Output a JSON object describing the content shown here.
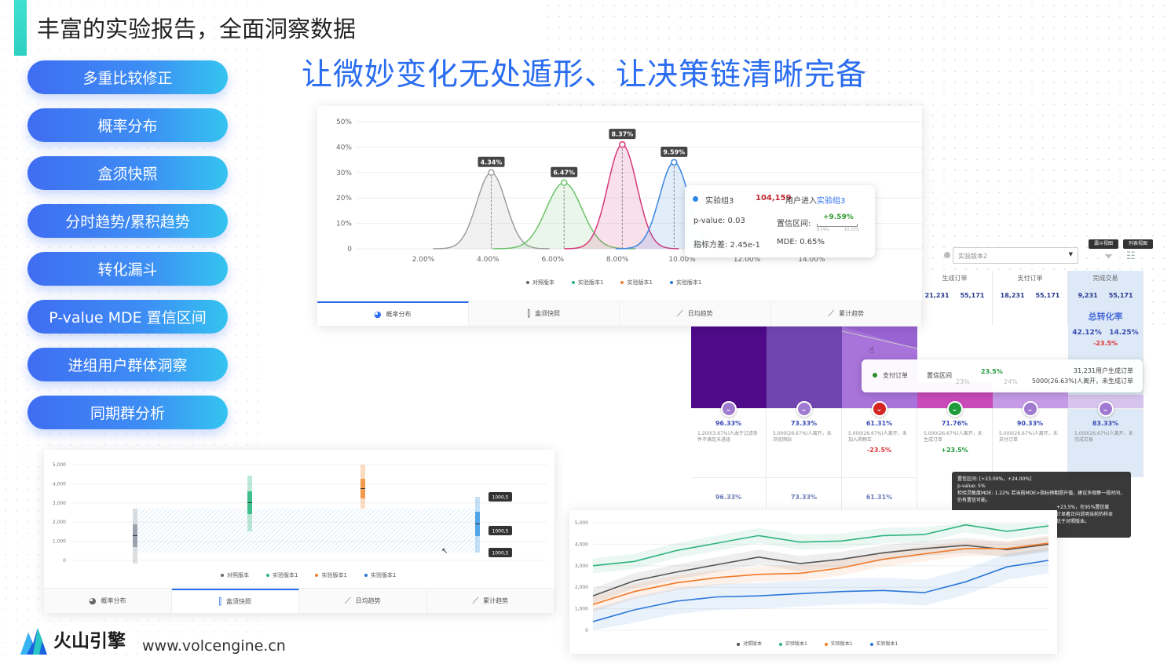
{
  "heading": "丰富的实验报告，全面洞察数据",
  "tagline": "让微妙变化无处遁形、让决策链清晰完备",
  "features": [
    "多重比较修正",
    "概率分布",
    "盒须快照",
    "分时趋势/累积趋势",
    "转化漏斗",
    "P-value MDE  置信区间",
    "进组用户群体洞察",
    "同期群分析"
  ],
  "tabs": [
    "概率分布",
    "盒须快照",
    "日均趋势",
    "累计趋势"
  ],
  "legend": [
    "对照版本",
    "实验版本1",
    "实验版本1",
    "实验版本1"
  ],
  "brand": {
    "name": "火山引擎",
    "url": "www.volcengine.cn"
  },
  "dist_chart": {
    "yticks": [
      "50%",
      "40%",
      "30%",
      "20%",
      "10%",
      "0"
    ],
    "xticks": [
      "2.00%",
      "4.00%",
      "6.00%",
      "8.00%",
      "10.00%",
      "12.00%",
      "14.00%"
    ],
    "peaks": [
      {
        "label": "4.34%",
        "mean": 4.1,
        "height": 0.3,
        "sd": 0.45,
        "color": "#9e9e9e"
      },
      {
        "label": "6.47%",
        "mean": 6.35,
        "height": 0.26,
        "sd": 0.55,
        "color": "#6cc26a"
      },
      {
        "label": "8.37%",
        "mean": 8.15,
        "height": 0.41,
        "sd": 0.45,
        "color": "#d6387a"
      },
      {
        "label": "9.59%",
        "mean": 9.75,
        "height": 0.34,
        "sd": 0.45,
        "color": "#3b86e0"
      }
    ],
    "tooltip": {
      "group": "实验组3",
      "users_count": "104,159",
      "users_text": "用户进入",
      "users_target": "实验组3",
      "pvalue": "p-value: 0.03",
      "ci_label": "置信区间:",
      "ci_value": "+9.59%",
      "ci_lo": "8.59%",
      "ci_hi": "10.23%",
      "variance": "指标方差: 2.45e-1",
      "mde": "MDE: 0.65%"
    }
  },
  "funnel": {
    "select_placeholder": "实验版本2",
    "view_buttons": [
      "漏斗视图",
      "列表视图"
    ],
    "columns": [
      {
        "title": "",
        "nums": [
          "",
          ""
        ]
      },
      {
        "title": "",
        "nums": [
          "",
          ""
        ]
      },
      {
        "title": "",
        "nums": [
          "",
          ""
        ]
      },
      {
        "title": "生成订单",
        "nums": [
          "21,231",
          "55,171"
        ]
      },
      {
        "title": "支付订单",
        "nums": [
          "18,231",
          "55,171"
        ]
      },
      {
        "title": "完成交易",
        "nums": [
          "9,231",
          "55,171"
        ]
      }
    ],
    "total_label": "总转化率",
    "total_vals": [
      "42.12%",
      "14.25%"
    ],
    "total_delta": "-23.5%",
    "tooltip": {
      "name": "支付订单",
      "ci_label": "置信区间",
      "ci": "23.5%",
      "lo": "23%",
      "hi": "24%",
      "line1": "31,231用户生成订单",
      "line2": "5000(26.63%)人离开，未生成订单"
    },
    "stats": [
      {
        "pct": "96.33%",
        "desc": "1,200(3.67%)人由于过滤条件不满足未进组",
        "delta": ""
      },
      {
        "pct": "73.33%",
        "desc": "5,000(26.67%)人离开，未浏览网站",
        "delta": ""
      },
      {
        "pct": "61.31%",
        "desc": "5,000(26.67%)人离开，未加入购物车",
        "delta": "-23.5%"
      },
      {
        "pct": "71.76%",
        "desc": "5,000(26.67%)人离开，未生成订单",
        "delta": "+23.5%"
      },
      {
        "pct": "90.33%",
        "desc": "5,000(26.67%)人离开，未支付订单",
        "delta": ""
      },
      {
        "pct": "83.33%",
        "desc": "5,000(26.67%)人离开，未完成交易",
        "delta": ""
      }
    ],
    "low_pcts": [
      "96.33%",
      "73.33%",
      "61.31%"
    ],
    "ci_tooltip": {
      "l1": "置信区间: [+23.00%，+24.00%]",
      "l2": "p-value: 5%",
      "l3": "检验灵敏度MDE: 1.22% 若当前MDE>指标预期提升值，建议多观察一段时间，仍有置信可能。",
      "l4": "+23.5%，在95%置信度",
      "l5": "计显著正向说明当前的样本",
      "l6": "优于对照版本。"
    }
  },
  "box_chart": {
    "yticks": [
      "5,000",
      "4,000",
      "3,000",
      "2,000",
      "1,000",
      "0"
    ],
    "labels": [
      "1000,5",
      "1000,5",
      "1000,5"
    ]
  },
  "trend_chart": {
    "yticks": [
      "5,000",
      "4,000",
      "3,000",
      "2,000",
      "1,000",
      "0"
    ]
  },
  "chart_data": [
    {
      "type": "area",
      "title": "",
      "xlabel": "",
      "ylabel": "",
      "x_ticks": [
        "2.00%",
        "4.00%",
        "6.00%",
        "8.00%",
        "10.00%",
        "12.00%",
        "14.00%"
      ],
      "ylim": [
        0,
        50
      ],
      "series": [
        {
          "name": "",
          "peak_x": 4.34,
          "peak_y": 30
        },
        {
          "name": "",
          "peak_x": 6.47,
          "peak_y": 26
        },
        {
          "name": "",
          "peak_x": 8.37,
          "peak_y": 41
        },
        {
          "name": "",
          "peak_x": 9.59,
          "peak_y": 34
        }
      ]
    },
    {
      "type": "line",
      "title": "",
      "xlabel": "",
      "ylabel": "",
      "ylim": [
        0,
        5000
      ],
      "x": [
        1,
        2,
        3,
        4,
        5,
        6,
        7,
        8,
        9,
        10,
        11,
        12
      ],
      "series": [
        {
          "name": "实验版本1",
          "values": [
            3000,
            3200,
            3700,
            4050,
            4400,
            4100,
            4150,
            4400,
            4450,
            4900,
            4600,
            4850
          ]
        },
        {
          "name": "对照版本",
          "values": [
            1600,
            2300,
            2700,
            3050,
            3400,
            3100,
            3300,
            3600,
            3800,
            3950,
            3750,
            4000
          ]
        },
        {
          "name": "实验版本1",
          "values": [
            1200,
            1800,
            2200,
            2450,
            2600,
            2650,
            2900,
            3300,
            3550,
            3800,
            3800,
            4050
          ]
        },
        {
          "name": "实验版本1",
          "values": [
            400,
            950,
            1350,
            1550,
            1600,
            1700,
            1800,
            1850,
            1750,
            2250,
            2950,
            3250
          ]
        }
      ]
    }
  ]
}
